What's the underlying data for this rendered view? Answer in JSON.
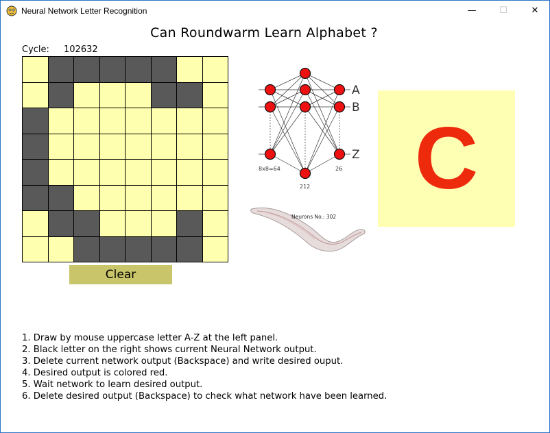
{
  "window": {
    "title": "Neural Network Letter Recognition",
    "controls": {
      "minimize": "—",
      "maximize": "☐",
      "close": "✕"
    }
  },
  "heading": "Can Roundwarm Learn Alphabet ?",
  "cycle": {
    "label": "Cycle:",
    "value": "102632"
  },
  "grid": {
    "rows": 8,
    "cols": 8,
    "cells": [
      [
        0,
        1,
        1,
        1,
        1,
        1,
        0,
        0
      ],
      [
        0,
        1,
        0,
        0,
        0,
        1,
        1,
        0
      ],
      [
        1,
        0,
        0,
        0,
        0,
        0,
        0,
        0
      ],
      [
        1,
        0,
        0,
        0,
        0,
        0,
        0,
        0
      ],
      [
        1,
        0,
        0,
        0,
        0,
        0,
        0,
        0
      ],
      [
        1,
        1,
        0,
        0,
        0,
        0,
        0,
        0
      ],
      [
        0,
        1,
        1,
        0,
        0,
        0,
        1,
        0
      ],
      [
        0,
        0,
        1,
        1,
        1,
        1,
        1,
        0
      ]
    ]
  },
  "clear_button": {
    "label": "Clear"
  },
  "network_diagram": {
    "output_labels": [
      "A",
      "B",
      "Z"
    ],
    "layer_labels": {
      "input": "8x8=64",
      "hidden": "212",
      "output": "26"
    }
  },
  "worm": {
    "caption": "Neurons No.: 302"
  },
  "output": {
    "letter": "C",
    "color": "#ee2a0c",
    "background": "#ffffb4"
  },
  "instructions": [
    "1. Draw by mouse uppercase letter A-Z at the left panel.",
    "2. Black letter on the right shows current Neural Network output.",
    "3. Delete current network output (Backspace) and write desired ouput.",
    "4. Desired output is colored red.",
    "5. Wait network to learn desired output.",
    "6. Delete desired output (Backspace) to check what network have been learned."
  ]
}
